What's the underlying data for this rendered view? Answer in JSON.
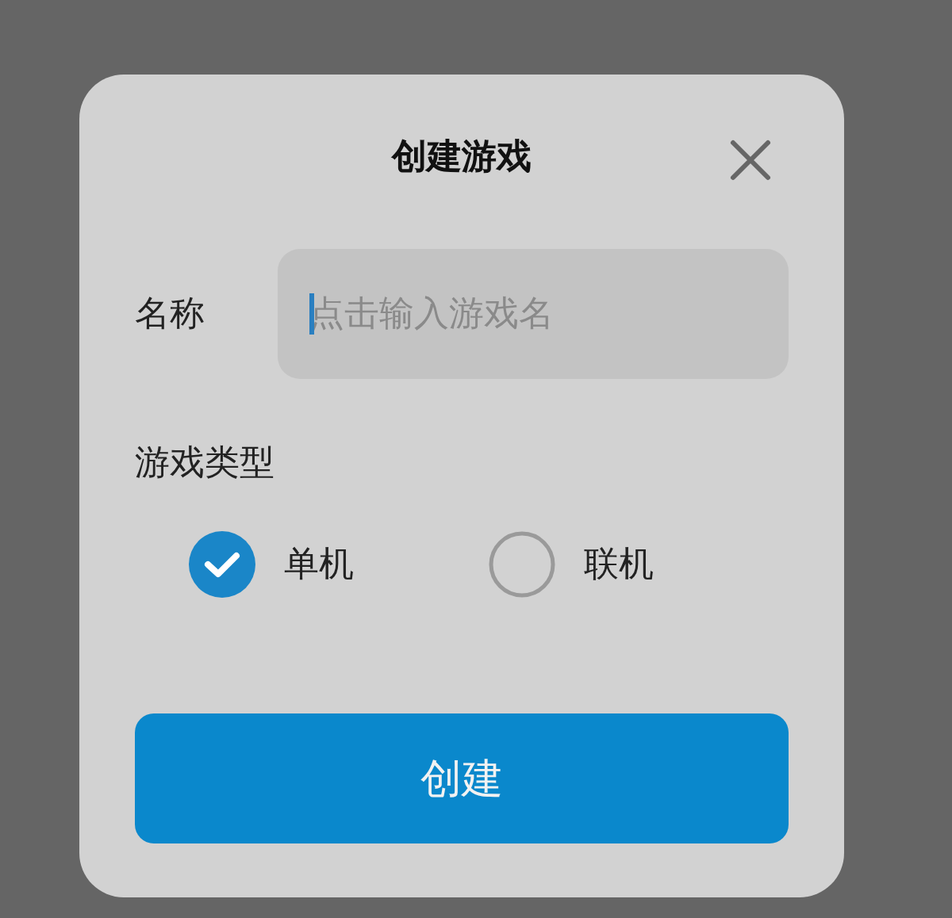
{
  "dialog": {
    "title": "创建游戏"
  },
  "name_field": {
    "label": "名称",
    "placeholder": "点击输入游戏名",
    "focused": true
  },
  "game_type": {
    "label": "游戏类型",
    "options": [
      {
        "label": "单机",
        "selected": true
      },
      {
        "label": "联机",
        "selected": false
      }
    ]
  },
  "submit_button": {
    "label": "创建"
  }
}
